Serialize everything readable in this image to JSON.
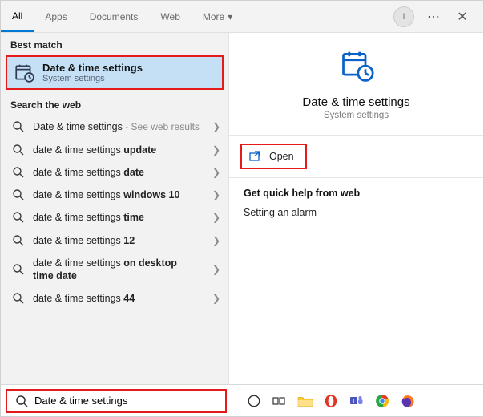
{
  "header": {
    "tabs": [
      "All",
      "Apps",
      "Documents",
      "Web",
      "More"
    ],
    "avatar_initial": "I"
  },
  "left": {
    "best_match_label": "Best match",
    "best_match": {
      "title": "Date & time settings",
      "subtitle": "System settings"
    },
    "web_label": "Search the web",
    "web": [
      {
        "prefix": "Date & time settings",
        "bold": "",
        "hint": " - See web results"
      },
      {
        "prefix": "date & time settings ",
        "bold": "update",
        "hint": ""
      },
      {
        "prefix": "date & time settings ",
        "bold": "date",
        "hint": ""
      },
      {
        "prefix": "date & time settings ",
        "bold": "windows 10",
        "hint": ""
      },
      {
        "prefix": "date & time settings ",
        "bold": "time",
        "hint": ""
      },
      {
        "prefix": "date & time settings ",
        "bold": "12",
        "hint": ""
      },
      {
        "prefix": "date & time settings ",
        "bold": "on desktop time date",
        "hint": ""
      },
      {
        "prefix": "date & time settings ",
        "bold": "44",
        "hint": ""
      }
    ]
  },
  "right": {
    "title": "Date & time settings",
    "subtitle": "System settings",
    "open_label": "Open",
    "help_header": "Get quick help from web",
    "help_items": [
      "Setting an alarm"
    ]
  },
  "search": {
    "value": "Date & time settings"
  },
  "colors": {
    "accent": "#0a62c9",
    "highlight_box": "#e51b1b",
    "selected_bg": "#c5e0f5"
  }
}
